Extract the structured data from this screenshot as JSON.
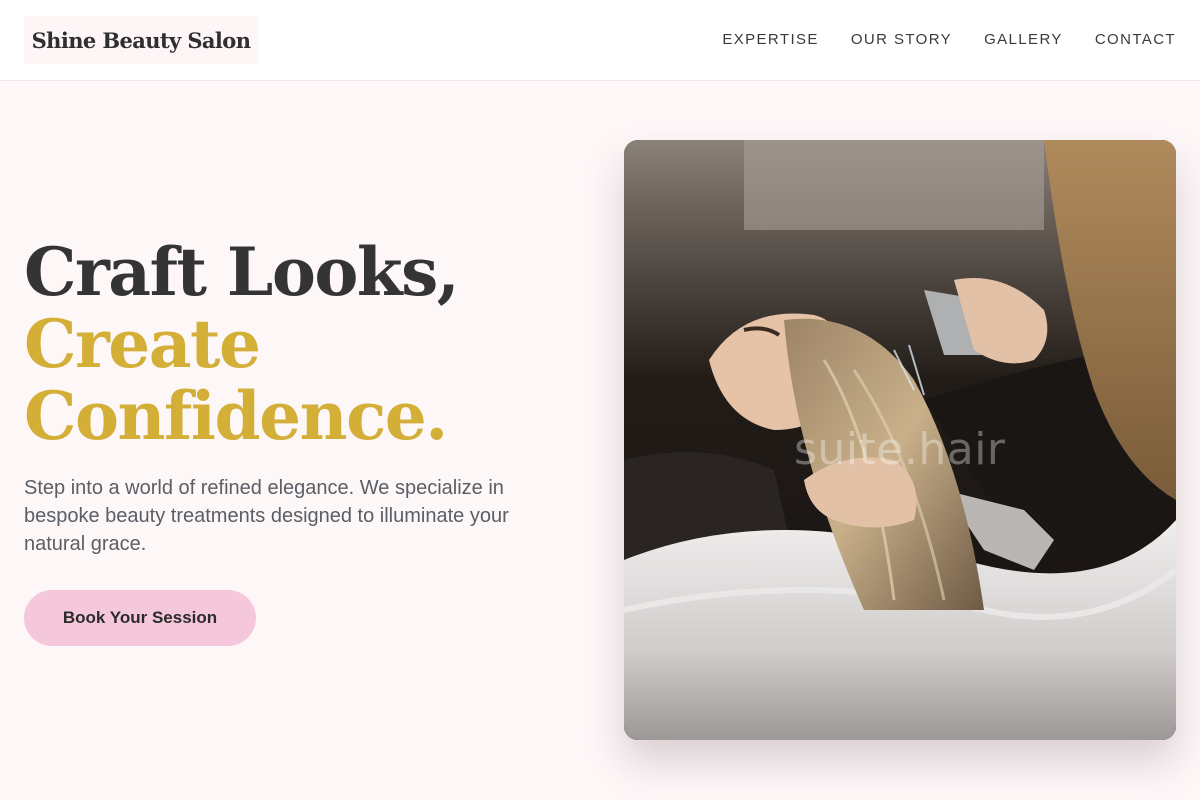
{
  "header": {
    "logo": "Shine Beauty Salon",
    "nav": [
      "EXPERTISE",
      "OUR STORY",
      "GALLERY",
      "CONTACT"
    ]
  },
  "hero": {
    "title_line1": "Craft Looks,",
    "title_line2": "Create",
    "title_line3": "Confidence.",
    "subtitle": "Step into a world of refined elegance. We specialize in bespoke beauty treatments designed to illuminate your natural grace.",
    "cta_label": "Book Your Session"
  },
  "photo": {
    "watermark": "suite.hair",
    "subject": "hair-washing-at-salon-basin"
  },
  "colors": {
    "accent_gold": "#d4af37",
    "cta_pink": "#f5c7da",
    "background": "#fdf7f8",
    "heading_dark": "#343434"
  }
}
